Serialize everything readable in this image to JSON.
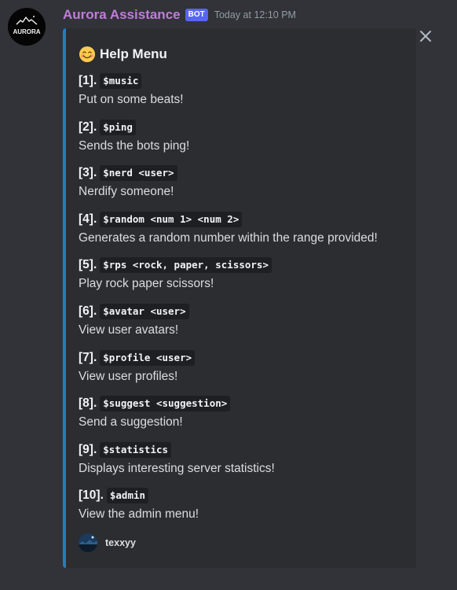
{
  "message": {
    "author": "Aurora Assistance",
    "bot_tag": "BOT",
    "timestamp": "Today at 12:10 PM",
    "avatar_text": "AURORA"
  },
  "embed": {
    "accent_color": "#1f7ec2",
    "title_emoji": "smiling-face-icon",
    "title": "Help Menu",
    "fields": [
      {
        "num": "[1].",
        "cmd": "$music",
        "desc": "Put on some beats!"
      },
      {
        "num": "[2].",
        "cmd": "$ping",
        "desc": "Sends the bots ping!"
      },
      {
        "num": "[3].",
        "cmd": "$nerd <user>",
        "desc": "Nerdify someone!"
      },
      {
        "num": "[4].",
        "cmd": "$random <num 1> <num 2>",
        "desc": "Generates a random number within the range provided!"
      },
      {
        "num": "[5].",
        "cmd": "$rps <rock, paper, scissors>",
        "desc": "Play rock paper scissors!"
      },
      {
        "num": "[6].",
        "cmd": "$avatar <user>",
        "desc": "View user avatars!"
      },
      {
        "num": "[7].",
        "cmd": "$profile <user>",
        "desc": "View user profiles!"
      },
      {
        "num": "[8].",
        "cmd": "$suggest <suggestion>",
        "desc": "Send a suggestion!"
      },
      {
        "num": "[9].",
        "cmd": "$statistics",
        "desc": "Displays interesting server statistics!"
      },
      {
        "num": "[10].",
        "cmd": "$admin",
        "desc": "View the admin menu!"
      }
    ],
    "footer": "texxyy"
  },
  "colors": {
    "background": "#313338",
    "embed_background": "#2b2d31",
    "username": "#c27bdc",
    "bot_tag": "#5865f2"
  }
}
